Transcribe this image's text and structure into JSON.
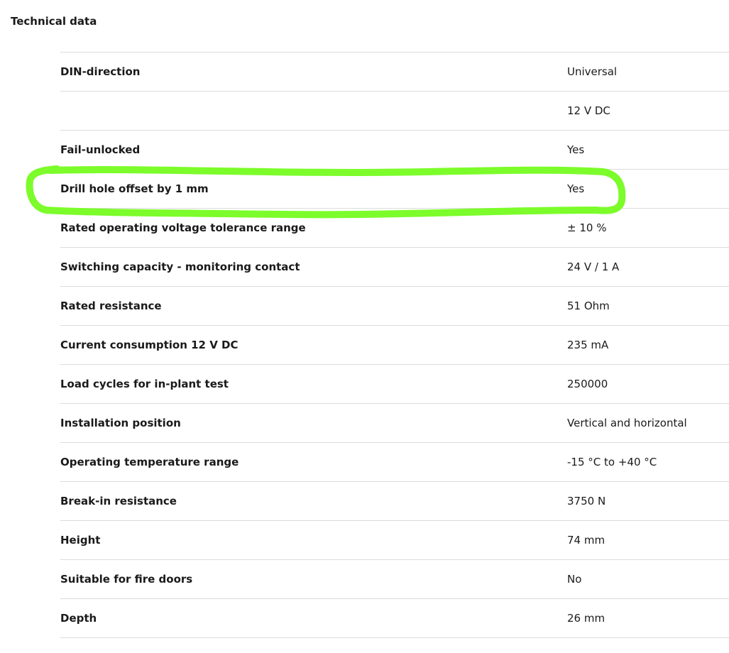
{
  "section": {
    "title": "Technical data"
  },
  "rows": [
    {
      "label": "DIN-direction",
      "value": "Universal"
    },
    {
      "label": "",
      "value": "12 V DC"
    },
    {
      "label": "Fail-unlocked",
      "value": "Yes"
    },
    {
      "label": "Drill hole offset by 1 mm",
      "value": "Yes"
    },
    {
      "label": "Rated operating voltage tolerance range",
      "value": "± 10 %"
    },
    {
      "label": "Switching capacity - monitoring contact",
      "value": "24 V / 1 A"
    },
    {
      "label": "Rated resistance",
      "value": "51 Ohm"
    },
    {
      "label": "Current consumption 12 V DC",
      "value": "235 mA"
    },
    {
      "label": "Load cycles for in-plant test",
      "value": "250000"
    },
    {
      "label": "Installation position",
      "value": "Vertical and horizontal"
    },
    {
      "label": "Operating temperature range",
      "value": "-15 °C to +40 °C"
    },
    {
      "label": "Break-in resistance",
      "value": "3750 N"
    },
    {
      "label": "Height",
      "value": "74 mm"
    },
    {
      "label": "Suitable for fire doors",
      "value": "No"
    },
    {
      "label": "Depth",
      "value": "26 mm"
    }
  ],
  "highlight": {
    "color": "#7CFC2A"
  }
}
